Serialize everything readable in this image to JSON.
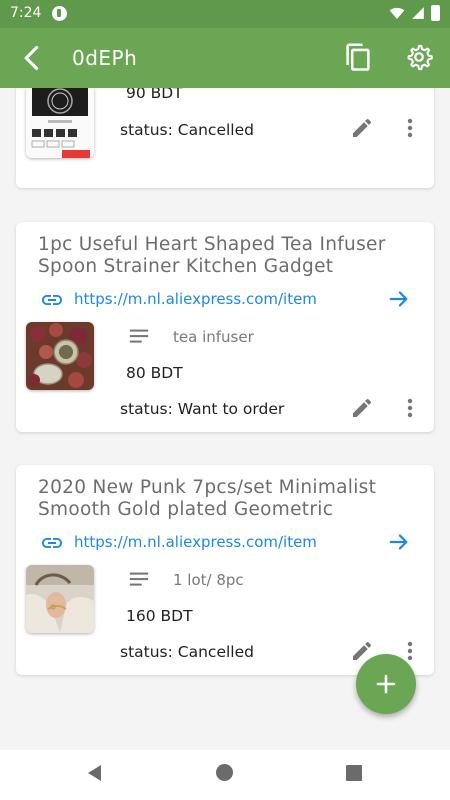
{
  "status_bar": {
    "time": "7:24"
  },
  "app_bar": {
    "title": "0dEPh"
  },
  "items": [
    {
      "price": "90 BDT",
      "status": "status: Cancelled"
    },
    {
      "title": "1pc Useful Heart Shaped Tea Infuser Spoon Strainer Kitchen Gadget",
      "link": "https://m.nl.aliexpress.com/item",
      "note": "tea infuser",
      "price": "80 BDT",
      "status": "status: Want to order"
    },
    {
      "title": "2020 New Punk 7pcs/set Minimalist Smooth Gold plated Geometric",
      "link": "https://m.nl.aliexpress.com/item",
      "note": "1 lot/ 8pc",
      "price": "160 BDT",
      "status": "status: Cancelled"
    }
  ],
  "colors": {
    "primary": "#6aa653",
    "status_bar": "#5f9a4c",
    "link": "#1e88e5"
  },
  "icons": [
    "back-arrow-icon",
    "copy-icon",
    "gear-icon",
    "link-icon",
    "open-arrow-icon",
    "notes-icon",
    "edit-icon",
    "more-vert-icon",
    "add-icon"
  ]
}
